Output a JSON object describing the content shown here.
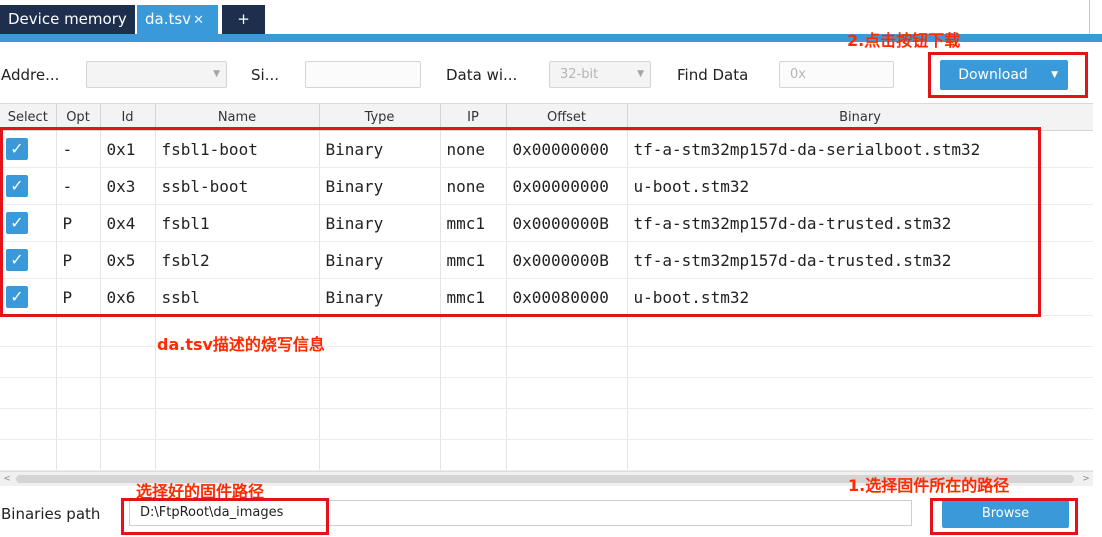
{
  "tabs": [
    {
      "label": "Device memory",
      "active": false
    },
    {
      "label": "da.tsv",
      "active": true,
      "close": "✕"
    },
    {
      "label": "+",
      "active": false
    }
  ],
  "toolbar": {
    "address_label": "Addre...",
    "size_label": "Si...",
    "data_width_label": "Data wi...",
    "data_width_value": "32-bit",
    "find_label": "Find Data",
    "find_placeholder": "0x",
    "download_label": "Download"
  },
  "annotations": {
    "download_note": "2.点击按钮下载",
    "table_note": "da.tsv描述的烧写信息",
    "path_note": "选择好的固件路径",
    "browse_note": "1.选择固件所在的路径"
  },
  "table": {
    "columns": [
      "Select",
      "Opt",
      "Id",
      "Name",
      "Type",
      "IP",
      "Offset",
      "Binary"
    ],
    "rows": [
      {
        "checked": true,
        "opt": "-",
        "id": "0x1",
        "name": "fsbl1-boot",
        "type": "Binary",
        "ip": "none",
        "offset": "0x00000000",
        "binary": "tf-a-stm32mp157d-da-serialboot.stm32"
      },
      {
        "checked": true,
        "opt": "-",
        "id": "0x3",
        "name": "ssbl-boot",
        "type": "Binary",
        "ip": "none",
        "offset": "0x00000000",
        "binary": "u-boot.stm32"
      },
      {
        "checked": true,
        "opt": "P",
        "id": "0x4",
        "name": "fsbl1",
        "type": "Binary",
        "ip": "mmc1",
        "offset": "0x0000000B",
        "binary": "tf-a-stm32mp157d-da-trusted.stm32"
      },
      {
        "checked": true,
        "opt": "P",
        "id": "0x5",
        "name": "fsbl2",
        "type": "Binary",
        "ip": "mmc1",
        "offset": "0x0000000B",
        "binary": "tf-a-stm32mp157d-da-trusted.stm32"
      },
      {
        "checked": true,
        "opt": "P",
        "id": "0x6",
        "name": "ssbl",
        "type": "Binary",
        "ip": "mmc1",
        "offset": "0x00080000",
        "binary": "u-boot.stm32"
      }
    ]
  },
  "bottom": {
    "binaries_path_label": "Binaries path",
    "binaries_path_value": "D:\\FtpRoot\\da_images",
    "browse_label": "Browse"
  },
  "colors": {
    "accent": "#3a9ad9",
    "tab_dark": "#1e2f4d",
    "annotation": "#ff2a00",
    "highlight_box": "#e4131a"
  }
}
